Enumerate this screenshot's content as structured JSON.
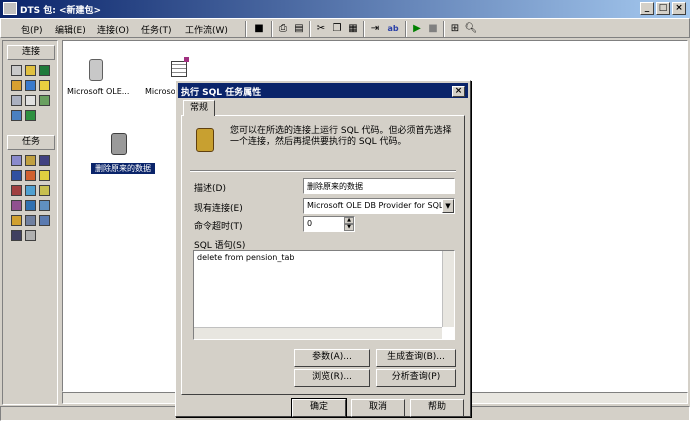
{
  "window": {
    "title": "DTS 包: <新建包>",
    "min": "_",
    "max": "□",
    "close": "×"
  },
  "menu": [
    "包(P)",
    "编辑(E)",
    "连接(O)",
    "任务(T)",
    "工作流(W)"
  ],
  "left_panel": {
    "connections_label": "连接",
    "tasks_label": "任务"
  },
  "canvas": {
    "task1_label": "Microsoft OLE...",
    "task2_label": "Microso",
    "task3_label": "删除原来的数据"
  },
  "dialog": {
    "title": "执行 SQL 任务属性",
    "close": "×",
    "tab_general": "常规",
    "info_text": "您可以在所选的连接上运行 SQL 代码。但必须首先选择一个连接，然后再提供要执行的 SQL 代码。",
    "description_label": "描述(D)",
    "description_value": "删除原来的数据",
    "connection_label": "现有连接(E)",
    "connection_value": "Microsoft OLE DB Provider for SQL Ser",
    "timeout_label": "命令超时(T)",
    "timeout_value": "0",
    "sql_label": "SQL 语句(S)",
    "sql_value": "delete from pension_tab",
    "params_button": "参数(A)...",
    "build_button": "生成查询(B)...",
    "browse_button": "浏览(R)...",
    "parse_button": "分析查询(P)",
    "ok_button": "确定",
    "cancel_button": "取消",
    "help_button": "帮助"
  }
}
